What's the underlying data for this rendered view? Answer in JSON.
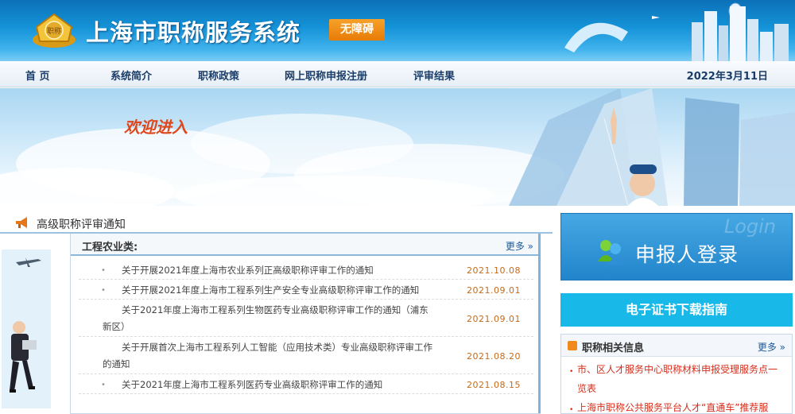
{
  "header": {
    "site_title": "上海市职称服务系统",
    "accessibility_label": "无障碍",
    "emblem_text": "职称"
  },
  "nav": {
    "items": [
      {
        "label": "首    页"
      },
      {
        "label": "系统简介"
      },
      {
        "label": "职称政策"
      },
      {
        "label": "网上职称申报注册"
      },
      {
        "label": "评审结果"
      }
    ],
    "date": "2022年3月11日"
  },
  "banner": {
    "welcome_text": "欢迎进入"
  },
  "notice": {
    "section_title": "高级职称评审通知",
    "category": "工程农业类:",
    "more_label": "更多 »",
    "items": [
      {
        "title": "关于开展2021年度上海市农业系列正高级职称评审工作的通知",
        "date": "2021.10.08"
      },
      {
        "title": "关于开展2021年度上海市工程系列生产安全专业高级职称评审工作的通知",
        "date": "2021.09.01"
      },
      {
        "title": "关于2021年度上海市工程系列生物医药专业高级职称评审工作的通知（浦东新区）",
        "date": "2021.09.01"
      },
      {
        "title": "关于开展首次上海市工程系列人工智能（应用技术类）专业高级职称评审工作的通知",
        "date": "2021.08.20"
      },
      {
        "title": "关于2021年度上海市工程系列医药专业高级职称评审工作的通知",
        "date": "2021.08.15"
      }
    ]
  },
  "login": {
    "label": "申报人登录",
    "ghost_text": "Login"
  },
  "cert_guide": {
    "label": "电子证书下载指南"
  },
  "related_info": {
    "title": "职称相关信息",
    "more_label": "更多 »",
    "links": [
      {
        "text": "市、区人才服务中心职称材料申报受理服务点一览表"
      },
      {
        "text": "上海市职称公共服务平台人才“直通车”推荐服"
      }
    ]
  },
  "colors": {
    "header_blue": "#1593d8",
    "accent_orange": "#e77b06",
    "date_orange": "#c66a1a",
    "link_red": "#d62c1a",
    "cert_cyan": "#18b9e8"
  }
}
